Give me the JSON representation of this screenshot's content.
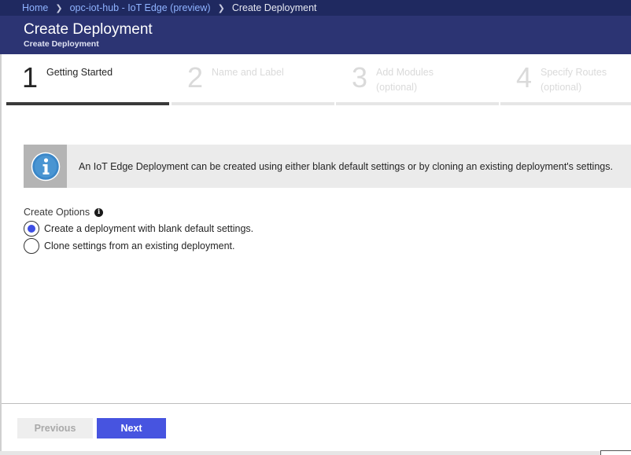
{
  "breadcrumb": {
    "home": "Home",
    "hub": "opc-iot-hub - IoT Edge (preview)",
    "current": "Create Deployment"
  },
  "header": {
    "title": "Create Deployment",
    "subtitle": "Create Deployment"
  },
  "steps": [
    {
      "number": "1",
      "label": "Getting Started",
      "label2": "",
      "state": "active"
    },
    {
      "number": "2",
      "label": "Name and Label",
      "label2": "",
      "state": "inactive"
    },
    {
      "number": "3",
      "label": "Add Modules",
      "label2": "(optional)",
      "state": "inactive"
    },
    {
      "number": "4",
      "label": "Specify Routes",
      "label2": "(optional)",
      "state": "inactive"
    }
  ],
  "info": {
    "icon": "info-icon",
    "text": "An IoT Edge Deployment can be created using either blank default settings or by cloning an existing deployment's settings."
  },
  "options": {
    "label": "Create Options",
    "tooltip_icon": "info-tooltip-icon",
    "items": [
      {
        "label": "Create a deployment with blank default settings.",
        "selected": true
      },
      {
        "label": "Clone settings from an existing deployment.",
        "selected": false
      }
    ]
  },
  "footer": {
    "previous_label": "Previous",
    "next_label": "Next"
  },
  "colors": {
    "breadcrumb_bg": "#1f2960",
    "header_bg": "#2c3473",
    "accent": "#4754e0",
    "radio_selected": "#3e4ee4",
    "info_icon": "#3b87c8"
  }
}
